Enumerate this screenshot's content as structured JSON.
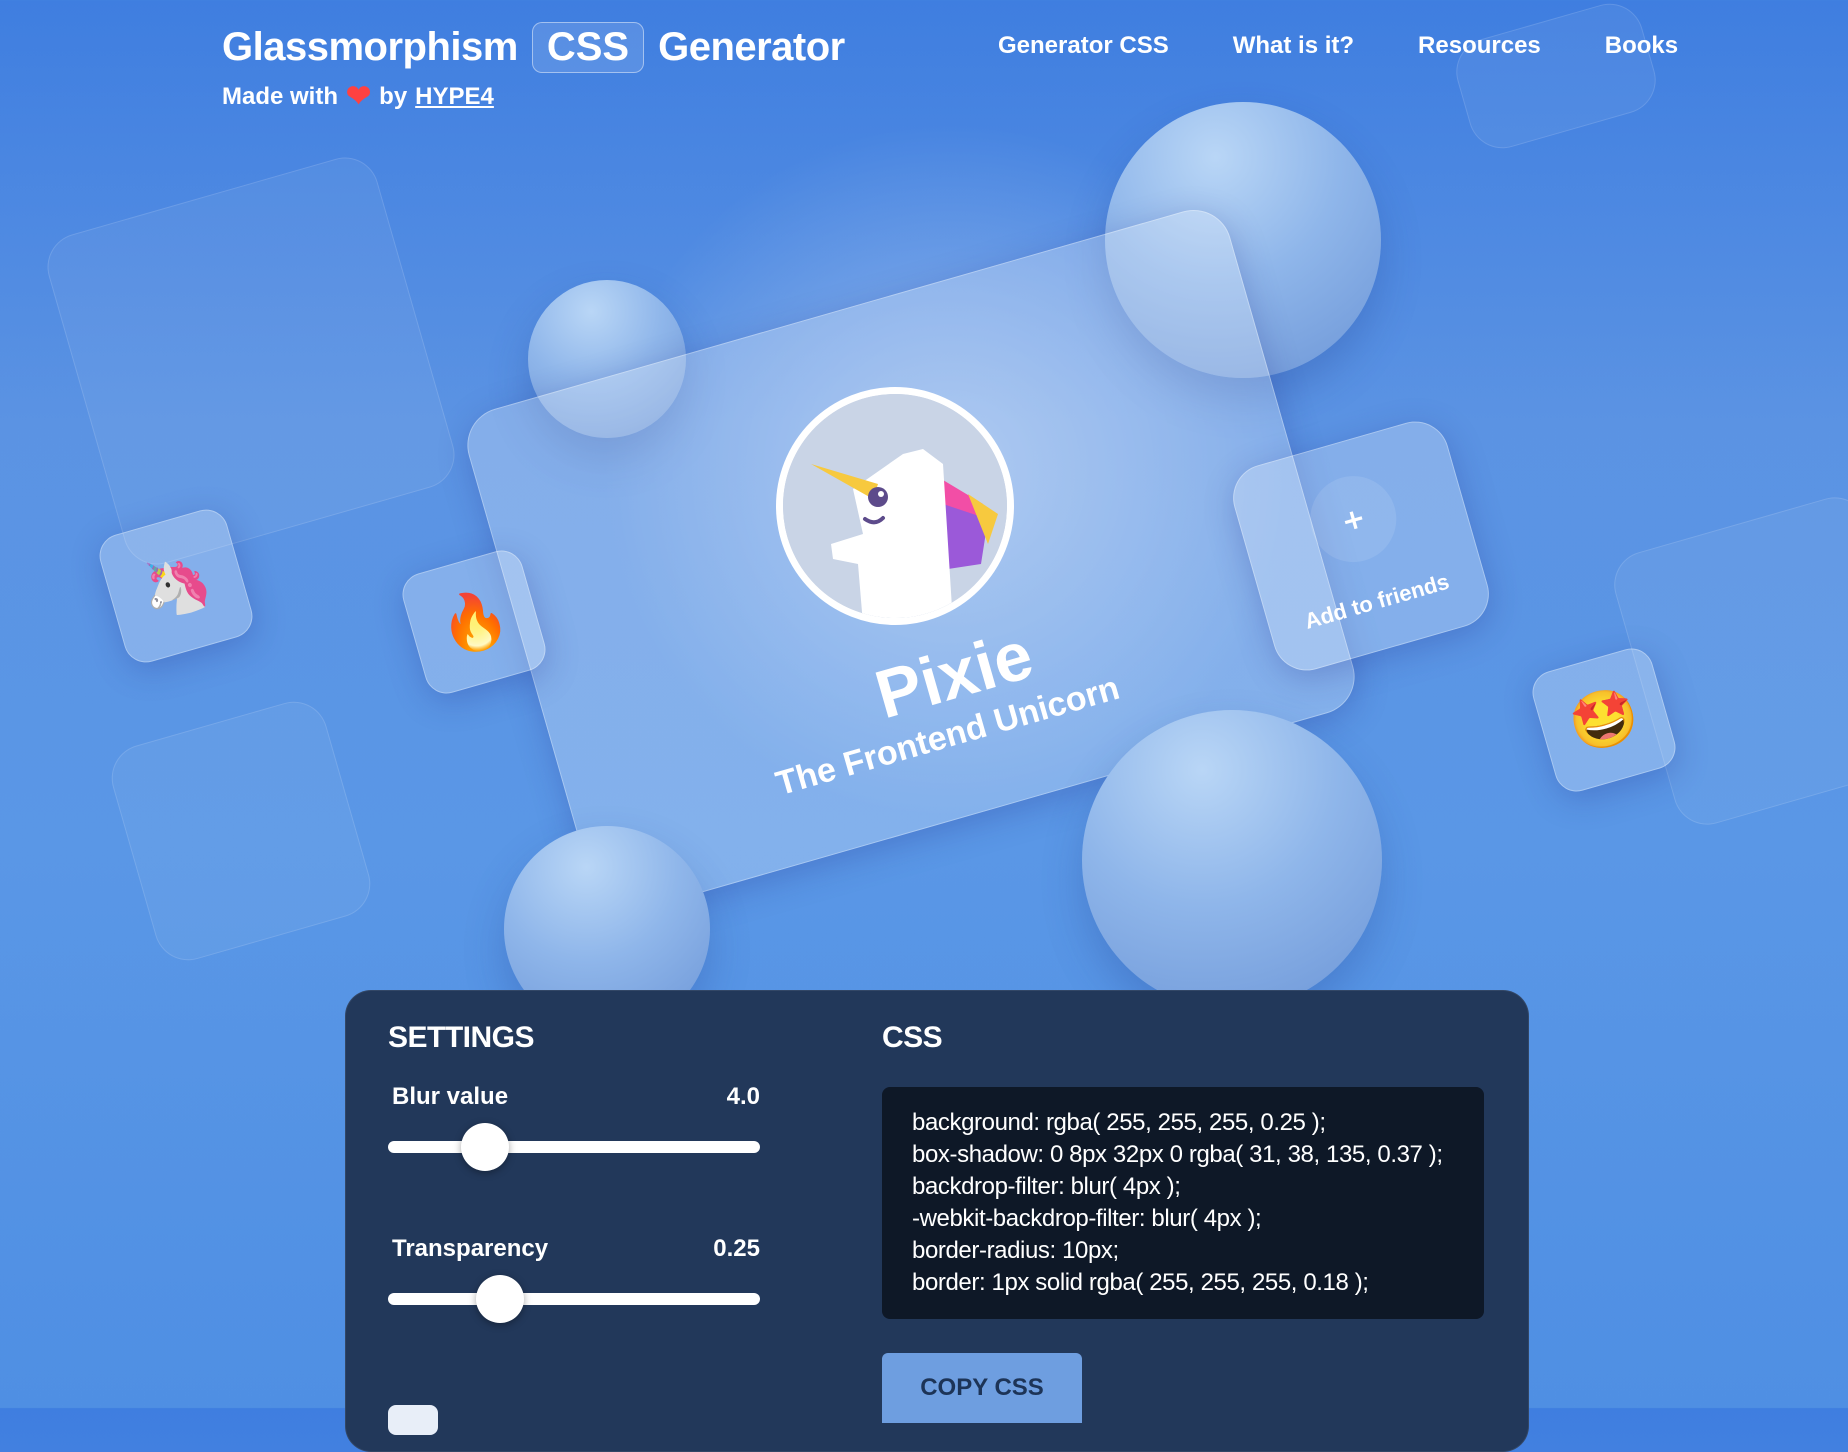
{
  "header": {
    "brand_left": "Glassmorphism",
    "brand_badge": "CSS",
    "brand_right": "Generator",
    "made_with": "Made with",
    "by": "by",
    "author_link": "HYPE4"
  },
  "nav": {
    "items": [
      "Generator CSS",
      "What is it?",
      "Resources",
      "Books"
    ]
  },
  "profile": {
    "name": "Pixie",
    "title": "The Frontend Unicorn",
    "add_icon": "+",
    "add_label": "Add to friends"
  },
  "emoji_tiles": {
    "unicorn": "🦄",
    "fire": "🔥",
    "star_struck": "🤩"
  },
  "settings": {
    "heading": "SETTINGS",
    "blur": {
      "label": "Blur value",
      "value": "4.0",
      "fraction": 0.24
    },
    "transparency": {
      "label": "Transparency",
      "value": "0.25",
      "fraction": 0.28
    }
  },
  "css_panel": {
    "heading": "CSS",
    "code_lines": [
      "background: rgba( 255, 255, 255, 0.25 );",
      "box-shadow: 0 8px 32px 0 rgba( 31, 38, 135, 0.37 );",
      "backdrop-filter: blur( 4px );",
      "-webkit-backdrop-filter: blur( 4px );",
      "border-radius: 10px;",
      "border: 1px solid rgba( 255, 255, 255, 0.18 );"
    ],
    "copy_button": "COPY CSS"
  },
  "colors": {
    "background": "#5a97e6",
    "panel": "#22385a",
    "code_bg": "#0e1827",
    "heart": "#ff4141",
    "copy_button": "#6e9ee0"
  }
}
